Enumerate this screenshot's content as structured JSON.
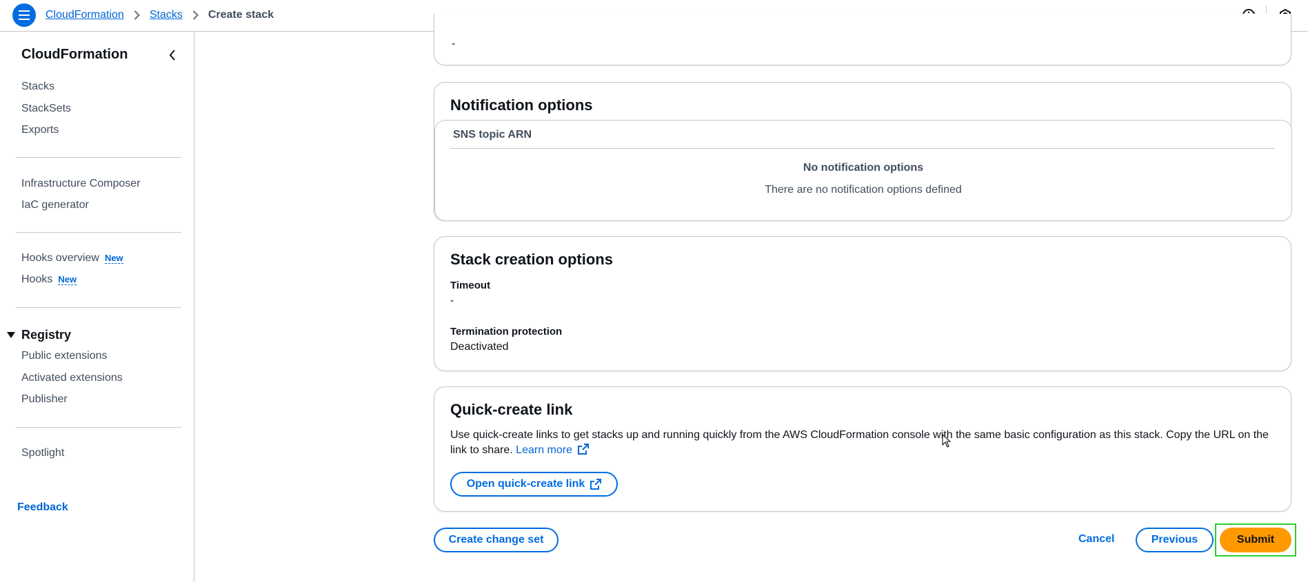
{
  "header": {
    "breadcrumbs": [
      "CloudFormation",
      "Stacks"
    ],
    "current": "Create stack",
    "icons": [
      "menu-icon",
      "info-icon",
      "settings-icon"
    ]
  },
  "sidebar": {
    "title": "CloudFormation",
    "group1": [
      "Stacks",
      "StackSets",
      "Exports"
    ],
    "group2": [
      "Infrastructure Composer",
      "IaC generator"
    ],
    "group3": [
      {
        "label": "Hooks overview",
        "badge": "New"
      },
      {
        "label": "Hooks",
        "badge": "New"
      }
    ],
    "registry": {
      "label": "Registry",
      "items": [
        "Public extensions",
        "Activated extensions",
        "Publisher"
      ]
    },
    "group4": [
      "Spotlight"
    ],
    "feedback": "Feedback"
  },
  "prev_section": {
    "value": "-"
  },
  "notification": {
    "title": "Notification options",
    "column": "SNS topic ARN",
    "empty_title": "No notification options",
    "empty_sub": "There are no notification options defined"
  },
  "stack_creation": {
    "title": "Stack creation options",
    "timeout_label": "Timeout",
    "timeout_value": "-",
    "termination_label": "Termination protection",
    "termination_value": "Deactivated"
  },
  "quick_create": {
    "title": "Quick-create link",
    "description": "Use quick-create links to get stacks up and running quickly from the AWS CloudFormation console with the same basic configuration as this stack. Copy the URL on the link to share.",
    "learn_more": "Learn more",
    "open_button": "Open quick-create link"
  },
  "footer": {
    "create_change_set": "Create change set",
    "cancel": "Cancel",
    "previous": "Previous",
    "submit": "Submit"
  },
  "colors": {
    "primary_blue": "#006ce0",
    "submit_orange": "#ff9900",
    "highlight_green": "#2ecc2e"
  }
}
